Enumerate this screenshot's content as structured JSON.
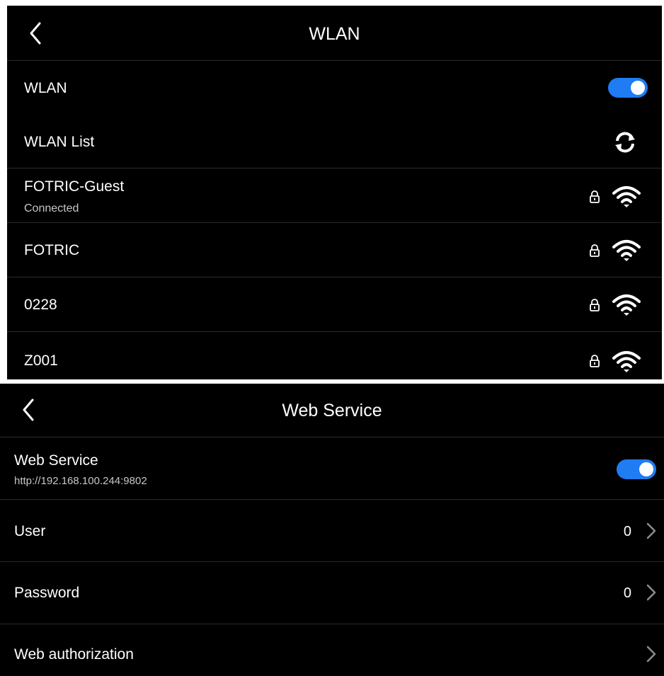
{
  "wlan_screen": {
    "title": "WLAN",
    "toggle_row": {
      "label": "WLAN",
      "enabled": true
    },
    "list_header": {
      "label": "WLAN List",
      "refresh_icon": "refresh-icon"
    },
    "networks": [
      {
        "ssid": "FOTRIC-Guest",
        "status": "Connected",
        "secured": true,
        "signal_icon": "wifi-icon",
        "lock_icon": "lock-icon"
      },
      {
        "ssid": "FOTRIC",
        "status": "",
        "secured": true,
        "signal_icon": "wifi-icon",
        "lock_icon": "lock-icon"
      },
      {
        "ssid": "0228",
        "status": "",
        "secured": true,
        "signal_icon": "wifi-icon",
        "lock_icon": "lock-icon"
      },
      {
        "ssid": "Z001",
        "status": "",
        "secured": true,
        "signal_icon": "wifi-icon",
        "lock_icon": "lock-icon"
      }
    ]
  },
  "web_screen": {
    "title": "Web Service",
    "service_row": {
      "label": "Web Service",
      "url": "http://192.168.100.244:9802",
      "enabled": true
    },
    "user_row": {
      "label": "User",
      "value": "0"
    },
    "password_row": {
      "label": "Password",
      "value": "0"
    },
    "authorization_row": {
      "label": "Web authorization"
    }
  },
  "colors": {
    "background": "#000000",
    "toggle_on": "#1f7cf2",
    "divider": "#2b2b2b",
    "chevron": "#8c8c8c",
    "secondary_text": "#c7c7c7"
  }
}
